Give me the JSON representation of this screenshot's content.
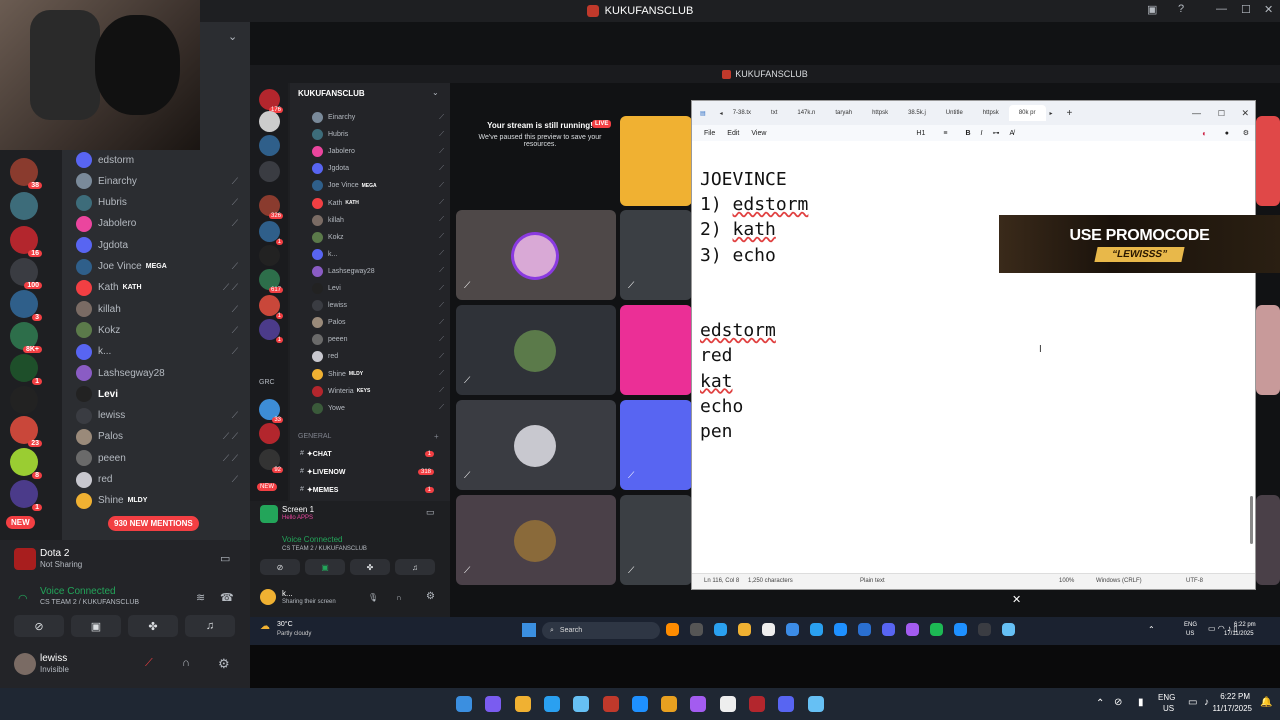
{
  "window": {
    "title": "KUKUFANSCLUB"
  },
  "left_members": [
    {
      "name": "edstorm",
      "icons": ""
    },
    {
      "name": "Einarchy",
      "icons": "⟋"
    },
    {
      "name": "Hubris",
      "icons": "⟋"
    },
    {
      "name": "Jabolero",
      "icons": "⟋"
    },
    {
      "name": "Jgdota",
      "icons": ""
    },
    {
      "name": "Joe Vince",
      "tag": "MEGA",
      "icons": "⟋"
    },
    {
      "name": "Kath",
      "tag": "KATH",
      "icons": "⟋ ⟋"
    },
    {
      "name": "killah",
      "icons": "⟋"
    },
    {
      "name": "Kokz",
      "icons": "⟋"
    },
    {
      "name": "k...",
      "icons": "⟋"
    },
    {
      "name": "Lashsegway28",
      "icons": ""
    },
    {
      "name": "Levi",
      "icons": ""
    },
    {
      "name": "lewiss",
      "icons": "⟋"
    },
    {
      "name": "Palos",
      "icons": "⟋ ⟋"
    },
    {
      "name": "peeen",
      "icons": "⟋ ⟋"
    },
    {
      "name": "red",
      "icons": "⟋"
    },
    {
      "name": "Shine",
      "tag": "MLDY",
      "icons": ""
    }
  ],
  "pills": {
    "new": "NEW",
    "mentions": "930 NEW MENTIONS"
  },
  "activity": {
    "game": "Dota 2",
    "status": "Not Sharing"
  },
  "voice": {
    "label": "Voice Connected",
    "channel": "CS TEAM 2 / KUKUFANSCLUB"
  },
  "user": {
    "name": "lewiss",
    "status": "Invisible"
  },
  "inner": {
    "server_name": "KUKUFANSCLUB",
    "channels": [
      {
        "name": "Einarchy"
      },
      {
        "name": "Hubris"
      },
      {
        "name": "Jabolero"
      },
      {
        "name": "Jgdota"
      },
      {
        "name": "Joe Vince",
        "tag": "MEGA"
      },
      {
        "name": "Kath",
        "tag": "KATH"
      },
      {
        "name": "killah"
      },
      {
        "name": "Kokz"
      },
      {
        "name": "k..."
      },
      {
        "name": "Lashsegway28"
      },
      {
        "name": "Levi"
      },
      {
        "name": "lewiss"
      },
      {
        "name": "Palos"
      },
      {
        "name": "peeen"
      },
      {
        "name": "red"
      },
      {
        "name": "Shine",
        "tag": "MLDY"
      },
      {
        "name": "Winteria",
        "tag": "KEYS"
      },
      {
        "name": "Yowe"
      }
    ],
    "general": "GENERAL",
    "text_channels": [
      {
        "name": "✦CHAT",
        "count": "1"
      },
      {
        "name": "✦LIVENOW",
        "count": "318"
      },
      {
        "name": "✦MEMES",
        "count": "1"
      }
    ],
    "screen_label": "Screen 1",
    "screen_sub": "Hello APPS",
    "voice_label": "Voice Connected",
    "voice_channel": "CS TEAM 2 / KUKUFANSCLUB",
    "user_name": "k...",
    "user_status": "Sharing their screen",
    "stream_msg_title": "Your stream is still running!",
    "stream_msg_body": "We've paused this preview to save your resources.",
    "live": "LIVE",
    "weather_temp": "30°C",
    "weather_desc": "Partly cloudy",
    "search": "Search",
    "lang": "ENG",
    "region": "US",
    "time": "6:22 pm",
    "date": "17/11/2025"
  },
  "notepad": {
    "tabs": [
      "7-38.tx",
      "txt",
      "147k.n",
      "taryah",
      "httpsk",
      "38.5k.j",
      "Untitle",
      "httpsk",
      "80k pr"
    ],
    "menu": [
      "File",
      "Edit",
      "View"
    ],
    "heading_btn": "H1",
    "lines": [
      "JOEVINCE",
      "1) edstorm",
      "2) kath",
      "3) echo",
      "",
      "",
      "edstorm",
      "red",
      "kat",
      "echo",
      "pen"
    ],
    "status": {
      "pos": "Ln 116, Col 8",
      "chars": "1,250 characters",
      "type": "Plain text",
      "zoom": "100%",
      "eol": "Windows (CRLF)",
      "enc": "UTF-8"
    }
  },
  "promo": {
    "line1": "USE PROMOCODE",
    "line2": "“LEWISSS”"
  },
  "taskbar": {
    "lang": "ENG",
    "region": "US",
    "time": "6:22 PM",
    "date": "11/17/2025"
  },
  "colors": {
    "accent": "#5865f2",
    "danger": "#f23f43",
    "voice": "#23a55a",
    "yellow": "#f0b132",
    "magenta": "#eb459e"
  }
}
